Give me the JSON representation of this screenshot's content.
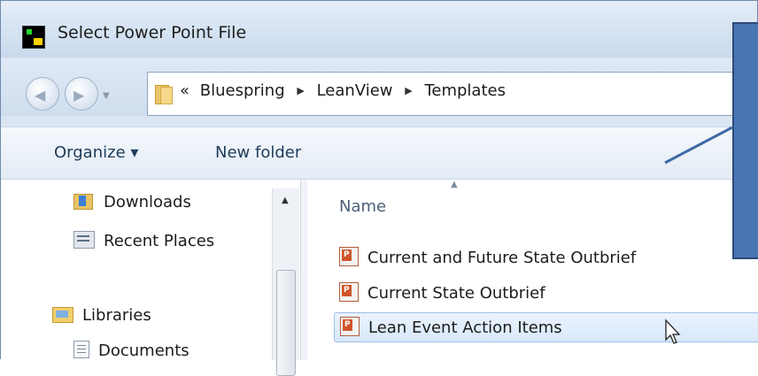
{
  "window": {
    "title": "Select Power Point File"
  },
  "address": {
    "overflow": "«",
    "crumbs": [
      "Bluespring",
      "LeanView",
      "Templates"
    ]
  },
  "toolbar": {
    "organize_label": "Organize ▾",
    "new_folder_label": "New folder"
  },
  "sidebar": {
    "items": [
      {
        "label": "Downloads",
        "icon": "downloads-icon"
      },
      {
        "label": "Recent Places",
        "icon": "recent-places-icon"
      },
      {
        "label": "Libraries",
        "icon": "libraries-icon"
      },
      {
        "label": "Documents",
        "icon": "documents-icon"
      }
    ]
  },
  "filelist": {
    "column_name": "Name",
    "files": [
      {
        "name": "Current and Future State Outbrief",
        "selected": false
      },
      {
        "name": "Current State Outbrief",
        "selected": false
      },
      {
        "name": "Lean Event Action Items",
        "selected": true
      }
    ]
  },
  "colors": {
    "callout": "#4a75b4",
    "selection": "#d8e8fb"
  }
}
